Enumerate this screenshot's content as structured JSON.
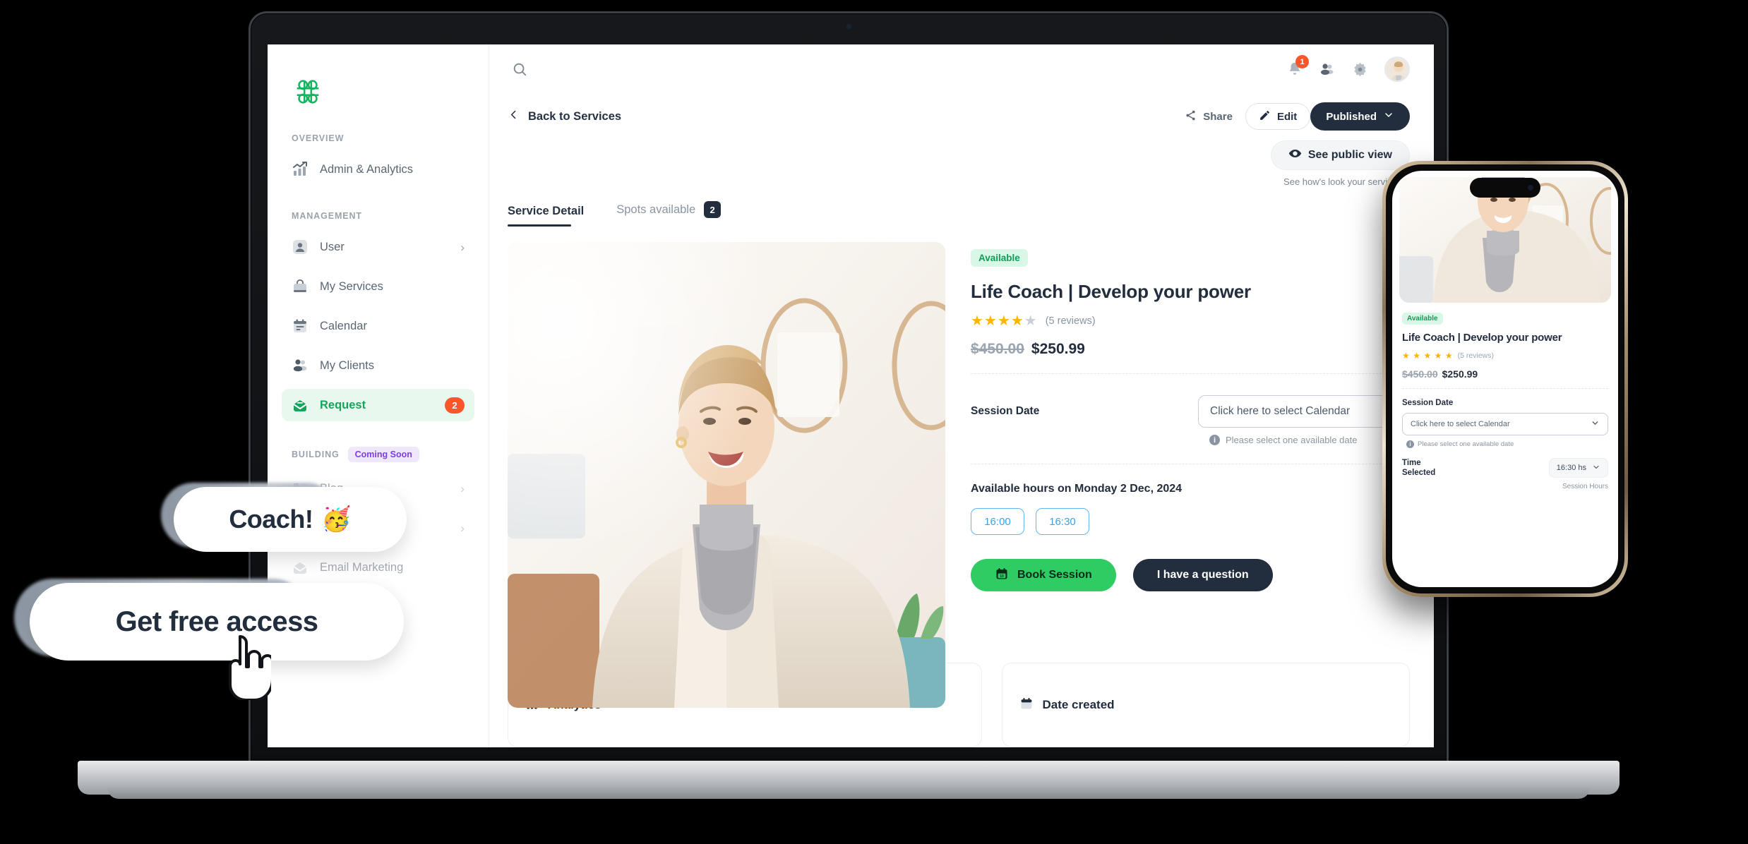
{
  "brand": {
    "logo_icon": "clover-knot-logo",
    "accent_green": "#16a35c",
    "dark": "#222d3d",
    "danger": "#f9572a"
  },
  "sidebar": {
    "groups": [
      {
        "label": "OVERVIEW",
        "badge": null,
        "items": [
          {
            "label": "Admin & Analytics",
            "icon": "analytics-chart-icon",
            "chevron": false,
            "badge": null,
            "active": false,
            "dim": false
          }
        ]
      },
      {
        "label": "MANAGEMENT",
        "badge": null,
        "items": [
          {
            "label": "User",
            "icon": "user-icon",
            "chevron": true,
            "badge": null,
            "active": false,
            "dim": false
          },
          {
            "label": "My Services",
            "icon": "briefcase-icon",
            "chevron": false,
            "badge": null,
            "active": false,
            "dim": false
          },
          {
            "label": "Calendar",
            "icon": "calendar-icon",
            "chevron": false,
            "badge": null,
            "active": false,
            "dim": false
          },
          {
            "label": "My Clients",
            "icon": "clients-icon",
            "chevron": false,
            "badge": null,
            "active": false,
            "dim": false
          },
          {
            "label": "Request",
            "icon": "inbox-icon",
            "chevron": false,
            "badge": "2",
            "active": true,
            "dim": false
          }
        ]
      },
      {
        "label": "BUILDING",
        "badge": "Coming Soon",
        "items": [
          {
            "label": "Blog",
            "icon": "blog-icon",
            "chevron": true,
            "badge": null,
            "active": false,
            "dim": true
          },
          {
            "label": "",
            "icon": "hidden-icon",
            "chevron": true,
            "badge": null,
            "active": false,
            "dim": true
          },
          {
            "label": "Email Marketing",
            "icon": "email-marketing-icon",
            "chevron": false,
            "badge": null,
            "active": false,
            "dim": true
          }
        ]
      }
    ]
  },
  "topbar": {
    "search_icon": "search-icon",
    "notifications_icon": "bell-icon",
    "notifications_count": "1",
    "contacts_icon": "contacts-icon",
    "settings_icon": "gear-icon",
    "avatar": "user-avatar"
  },
  "header": {
    "back_label": "Back to Services",
    "back_icon": "chevron-left-icon",
    "share_label": "Share",
    "share_icon": "share-icon",
    "edit_label": "Edit",
    "edit_icon": "pencil-icon",
    "status_label": "Published",
    "status_chevron_icon": "chevron-down-icon",
    "public_view_label": "See public view",
    "public_view_icon": "eye-icon",
    "public_view_hint": "See how's look your service"
  },
  "tabs": [
    {
      "label": "Service Detail",
      "count": null,
      "active": true
    },
    {
      "label": "Spots available",
      "count": "2",
      "active": false
    }
  ],
  "service": {
    "availability_badge": "Available",
    "title": "Life Coach | Develop your power",
    "rating_filled": 4,
    "rating_total": 5,
    "reviews_label": "(5 reviews)",
    "price_old": "$450.00",
    "price_new": "$250.99",
    "session_date_label": "Session Date",
    "session_date_value": "Click here to select Calendar",
    "session_date_chevron": "chevron-down-icon",
    "session_date_hint": "Please select one available date",
    "hours_title": "Available hours on Monday 2 Dec, 2024",
    "hours": [
      "16:00",
      "16:30"
    ],
    "book_label": "Book Session",
    "book_icon": "calendar-icon",
    "question_label": "I have a question",
    "hero_alt": "Smiling blonde woman in cream blazer and grey turtleneck"
  },
  "bottom_cards": [
    {
      "title": "Analytics",
      "icon": "analytics-chart-icon"
    },
    {
      "title": "Date created",
      "icon": "calendar-icon"
    }
  ],
  "phone": {
    "availability_badge": "Available",
    "title": "Life Coach | Develop your power",
    "rating_filled": 5,
    "reviews_label": "(5 reviews)",
    "price_old": "$450.00",
    "price_new": "$250.99",
    "session_date_label": "Session Date",
    "session_date_value": "Click here to select Calendar",
    "session_date_hint": "Please select one available date",
    "time_label_line1": "Time",
    "time_label_line2": "Selected",
    "time_value": "16:30 hs",
    "session_hours_label": "Session Hours"
  },
  "overlays": {
    "bubble1_text": "Coach!",
    "bubble1_emoji": "🥳",
    "bubble2_text": "Get free access",
    "cursor_icon": "pointing-hand-cursor-icon"
  }
}
